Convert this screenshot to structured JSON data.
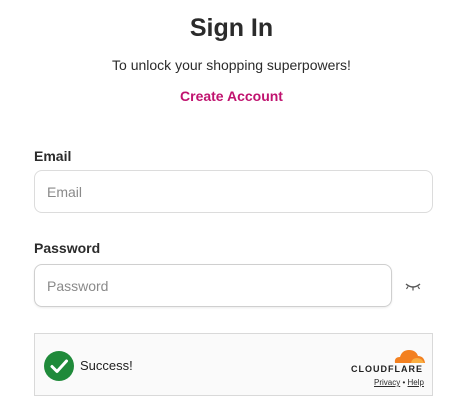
{
  "header": {
    "title": "Sign In",
    "subtitle": "To unlock your shopping superpowers!",
    "create_account": "Create Account"
  },
  "form": {
    "email_label": "Email",
    "email_placeholder": "Email",
    "password_label": "Password",
    "password_placeholder": "Password",
    "password_toggle_icon": "eye-closed-icon"
  },
  "captcha": {
    "status": "Success!",
    "status_icon": "check-circle-icon",
    "brand": "CLOUDFLARE",
    "privacy": "Privacy",
    "separator": "•",
    "help": "Help",
    "colors": {
      "check": "#1f8a3a",
      "cloud": "#f38020"
    }
  },
  "colors": {
    "accent": "#c0136f",
    "text": "#2b2b2b"
  }
}
